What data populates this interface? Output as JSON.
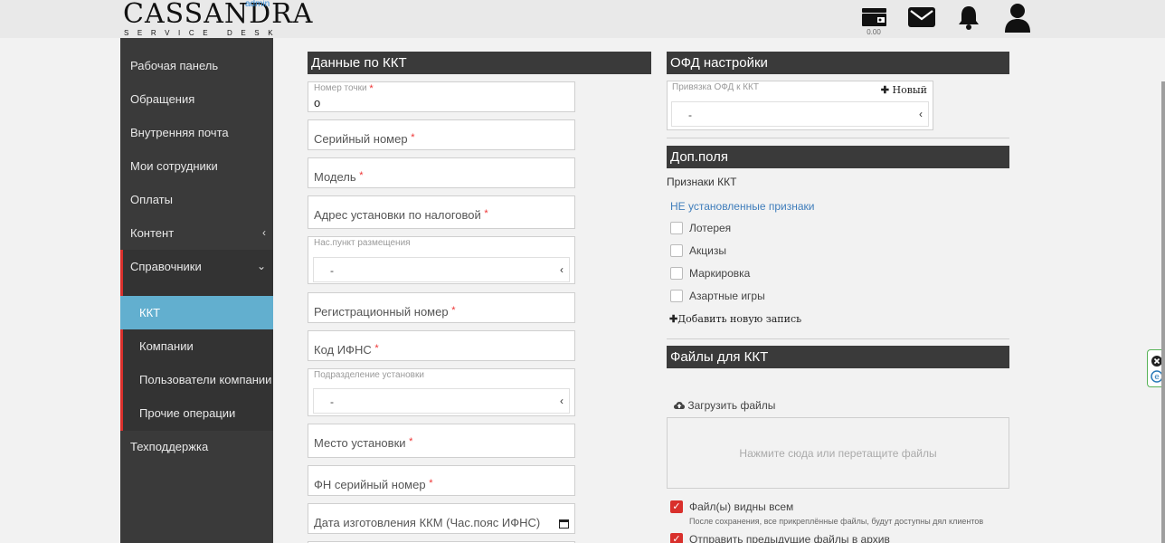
{
  "header": {
    "logo_main": "CASSANDRA",
    "logo_sub": "SERVICE DESK",
    "role": "admin",
    "wallet_value": "0.00"
  },
  "sidebar": {
    "items": [
      {
        "label": "Рабочая панель"
      },
      {
        "label": "Обращения"
      },
      {
        "label": "Внутренняя почта"
      },
      {
        "label": "Мои сотрудники"
      },
      {
        "label": "Оплаты"
      },
      {
        "label": "Контент",
        "chevron": "‹"
      },
      {
        "label": "Справочники",
        "chevron": "⌄"
      }
    ],
    "sub_items": [
      {
        "label": "ККТ"
      },
      {
        "label": "Компании"
      },
      {
        "label": "Пользователи компании"
      },
      {
        "label": "Прочие операции"
      }
    ],
    "footer_item": {
      "label": "Техподдержка"
    }
  },
  "main": {
    "kkt_title": "Данные по ККТ",
    "fields": {
      "point_number_label": "Номер точки",
      "point_number_value": "о",
      "serial": "Серийный номер",
      "model": "Модель",
      "tax_address": "Адрес установки по налоговой",
      "locality_label": "Нас.пункт размещения",
      "locality_value": "-",
      "reg_number": "Регистрационный номер",
      "ifns_code": "Код ИФНС",
      "division_label": "Подразделение установки",
      "division_value": "-",
      "install_place": "Место установки",
      "fn_serial": "ФН серийный номер",
      "manufacture_date": "Дата изготовления ККМ (Час.пояс ИФНС)",
      "required_mark": "*"
    }
  },
  "ofd": {
    "title": "ОФД настройки",
    "binding_label": "Привязка ОФД к ККТ",
    "new_label": "Новый",
    "value": "-"
  },
  "extra": {
    "title": "Доп.поля",
    "signs_label": "Признаки ККТ",
    "not_set_link": "НЕ установленные признаки",
    "options": [
      "Лотерея",
      "Акцизы",
      "Маркировка",
      "Азартные игры"
    ],
    "add_record": "Добавить новую запись"
  },
  "files": {
    "title": "Файлы для ККТ",
    "upload": "Загрузить файлы",
    "drop_hint": "Нажмите сюда или перетащите файлы",
    "visible_all": "Файл(ы) видны всем",
    "visible_note": "После сохранения, все прикреплённые файлы, будут доступны дял клиентов",
    "send_archive": "Отправить предыдущие файлы в архив"
  },
  "colors": {
    "sidebar_bg": "#3a3a3a",
    "active_item": "#62afcf",
    "accent_red": "#d9302c",
    "link_blue": "#3f7dbb"
  }
}
